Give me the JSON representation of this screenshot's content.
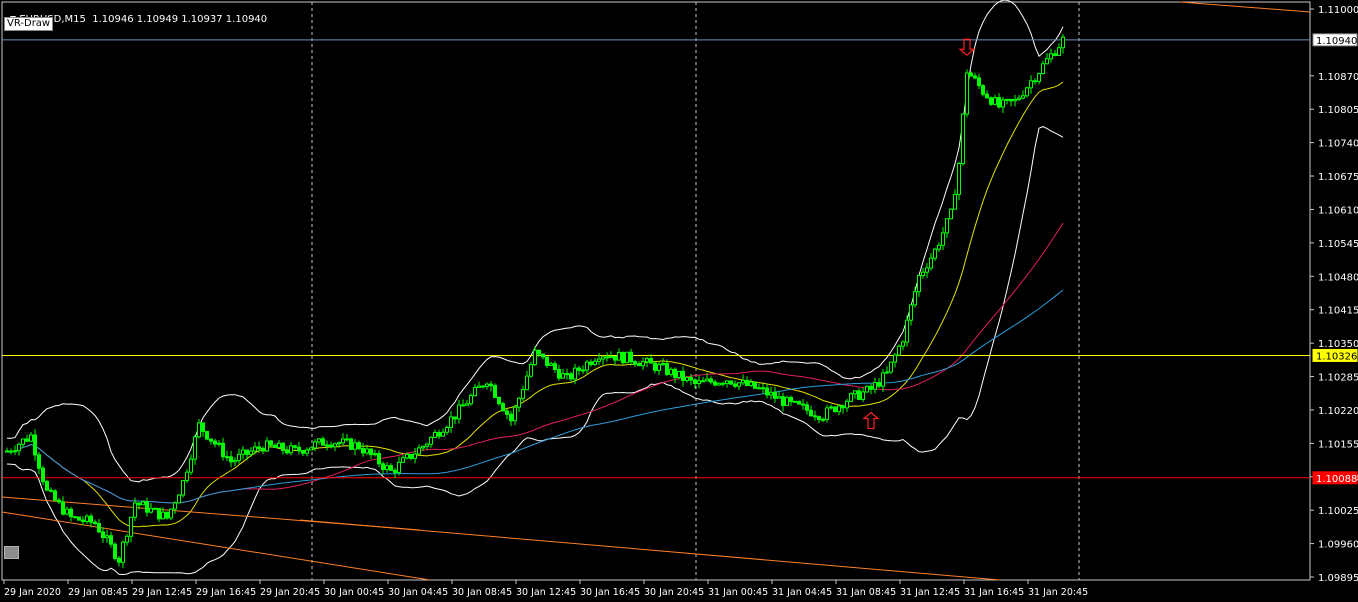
{
  "header": {
    "symbol_timeframe": "EURUSD,M15",
    "ohlc": "1.10946 1.10949 1.10937 1.10940"
  },
  "indicator_button": "VR-Draw",
  "colors": {
    "background": "#000000",
    "candle": "#00ff00",
    "bollinger": "#ffffff",
    "ma_fast": "#e0e000",
    "ma_mid": "#e0205a",
    "ma_slow": "#2d9cdb",
    "trend_line": "#ff7f27",
    "hline_yellow": "#ffff00",
    "hline_red": "#ff0000",
    "hline_bid": "#6f8fb8",
    "arrow": "#ff2020"
  },
  "price_axis": {
    "ticks": [
      "1.11000",
      "1.10870",
      "1.10805",
      "1.10740",
      "1.10675",
      "1.10610",
      "1.10545",
      "1.10480",
      "1.10415",
      "1.10350",
      "1.10285",
      "1.10220",
      "1.10155",
      "1.10090",
      "1.10025",
      "1.09960",
      "1.09895"
    ],
    "current_price_label": "1.10940",
    "yellow_level_label": "1.10326",
    "red_level_label": "1.10088"
  },
  "time_axis": {
    "labels": [
      "29 Jan 2020",
      "29 Jan 08:45",
      "29 Jan 12:45",
      "29 Jan 16:45",
      "29 Jan 20:45",
      "30 Jan 00:45",
      "30 Jan 04:45",
      "30 Jan 08:45",
      "30 Jan 12:45",
      "30 Jan 16:45",
      "30 Jan 20:45",
      "31 Jan 00:45",
      "31 Jan 04:45",
      "31 Jan 08:45",
      "31 Jan 12:45",
      "31 Jan 16:45",
      "31 Jan 20:45"
    ]
  },
  "chart_data": {
    "type": "candlestick",
    "symbol": "EURUSD",
    "timeframe": "M15",
    "y_range": [
      1.09895,
      1.11
    ],
    "horizontal_levels": [
      1.1094,
      1.10326,
      1.10088
    ],
    "price_path": [
      [
        0,
        1.1014
      ],
      [
        6,
        1.1017
      ],
      [
        10,
        1.1006
      ],
      [
        16,
        1.1001
      ],
      [
        22,
        1.1
      ],
      [
        28,
        1.0993
      ],
      [
        32,
        1.1004
      ],
      [
        40,
        1.1001
      ],
      [
        44,
        1.1008
      ],
      [
        48,
        1.1019
      ],
      [
        56,
        1.1012
      ],
      [
        64,
        1.1015
      ],
      [
        72,
        1.1014
      ],
      [
        80,
        1.1016
      ],
      [
        88,
        1.1015
      ],
      [
        96,
        1.101
      ],
      [
        104,
        1.1015
      ],
      [
        112,
        1.1021
      ],
      [
        120,
        1.1028
      ],
      [
        126,
        1.102
      ],
      [
        132,
        1.1033
      ],
      [
        140,
        1.1028
      ],
      [
        148,
        1.1033
      ],
      [
        156,
        1.1032
      ],
      [
        164,
        1.103
      ],
      [
        172,
        1.1027
      ],
      [
        180,
        1.1028
      ],
      [
        188,
        1.1026
      ],
      [
        196,
        1.1023
      ],
      [
        204,
        1.1021
      ],
      [
        210,
        1.1024
      ],
      [
        216,
        1.1026
      ],
      [
        220,
        1.1029
      ],
      [
        224,
        1.1036
      ],
      [
        228,
        1.1048
      ],
      [
        232,
        1.1053
      ],
      [
        236,
        1.106
      ],
      [
        238,
        1.107
      ],
      [
        240,
        1.1088
      ],
      [
        244,
        1.1084
      ],
      [
        248,
        1.1081
      ],
      [
        252,
        1.1082
      ],
      [
        256,
        1.1086
      ],
      [
        260,
        1.109
      ],
      [
        264,
        1.1094
      ]
    ],
    "arrows": [
      {
        "direction": "down",
        "bar": 240,
        "price": 1.1091
      },
      {
        "direction": "up",
        "bar": 216,
        "price": 1.10215
      }
    ]
  }
}
